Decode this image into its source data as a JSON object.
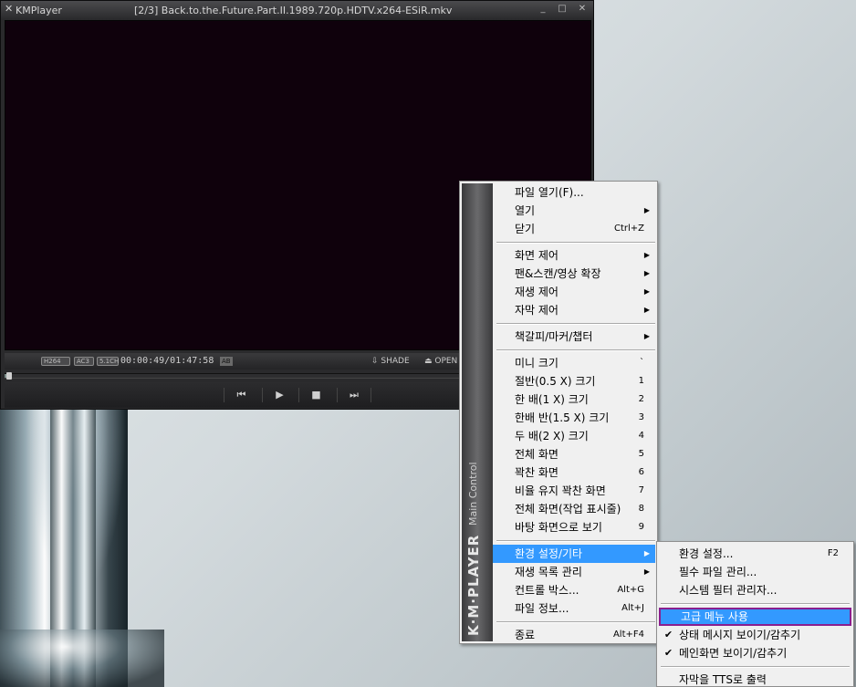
{
  "player": {
    "app_name": "KMPlayer",
    "window_title": "[2/3] Back.to.the.Future.Part.II.1989.720p.HDTV.x264-ESiR.mkv",
    "window_controls": {
      "minimize": "_",
      "maximize": "□",
      "close": "✕"
    },
    "status": {
      "codec_video": "H264",
      "codec_audio": "AC3",
      "codec_channels": "5.1CH",
      "time": "00:00:49/01:47:58",
      "ab_badge": "AB",
      "shade_label": "⇩ SHADE",
      "open_label": "⏏ OPEN"
    },
    "playback_progress": 0.0076,
    "controls": {
      "prev": "⏮",
      "play": "▶",
      "stop": "■",
      "next": "⏭"
    }
  },
  "menu": {
    "banner_brand": "K·M·PLAYER",
    "banner_sub": "Main Control",
    "items": [
      {
        "label": "파일 열기(F)...",
        "accel": "",
        "submenu": false
      },
      {
        "label": "열기",
        "accel": "",
        "submenu": true
      },
      {
        "label": "닫기",
        "accel": "Ctrl+Z",
        "submenu": false
      },
      {
        "label": "화면 제어",
        "accel": "",
        "submenu": true
      },
      {
        "label": "팬&스캔/영상 확장",
        "accel": "",
        "submenu": true
      },
      {
        "label": "재생 제어",
        "accel": "",
        "submenu": true
      },
      {
        "label": "자막 제어",
        "accel": "",
        "submenu": true
      },
      {
        "label": "책갈피/마커/챕터",
        "accel": "",
        "submenu": true
      },
      {
        "label": "미니 크기",
        "accel": "`",
        "submenu": false
      },
      {
        "label": "절반(0.5 X) 크기",
        "accel": "1",
        "submenu": false
      },
      {
        "label": "한 배(1 X) 크기",
        "accel": "2",
        "submenu": false
      },
      {
        "label": "한배 반(1.5 X) 크기",
        "accel": "3",
        "submenu": false
      },
      {
        "label": "두 배(2 X) 크기",
        "accel": "4",
        "submenu": false
      },
      {
        "label": "전체 화면",
        "accel": "5",
        "submenu": false
      },
      {
        "label": "꽉찬 화면",
        "accel": "6",
        "submenu": false
      },
      {
        "label": "비율 유지 꽉찬 화면",
        "accel": "7",
        "submenu": false
      },
      {
        "label": "전체 화면(작업 표시줄)",
        "accel": "8",
        "submenu": false
      },
      {
        "label": "바탕 화면으로 보기",
        "accel": "9",
        "submenu": false
      },
      {
        "label": "환경 설정/기타",
        "accel": "",
        "submenu": true
      },
      {
        "label": "재생 목록 관리",
        "accel": "",
        "submenu": true
      },
      {
        "label": "컨트롤 박스...",
        "accel": "Alt+G",
        "submenu": false
      },
      {
        "label": "파일 정보...",
        "accel": "Alt+J",
        "submenu": false
      },
      {
        "label": "종료",
        "accel": "Alt+F4",
        "submenu": false
      }
    ],
    "submenu_arrow": "▶"
  },
  "submenu": {
    "items": [
      {
        "label": "환경 설정...",
        "accel": "F2",
        "checked": false
      },
      {
        "label": "필수 파일 관리...",
        "accel": "",
        "checked": false
      },
      {
        "label": "시스템 필터 관리자...",
        "accel": "",
        "checked": false
      },
      {
        "label": "고급 메뉴 사용",
        "accel": "",
        "checked": false
      },
      {
        "label": "상태 메시지 보이기/감추기",
        "accel": "",
        "checked": true
      },
      {
        "label": "메인화면 보이기/감추기",
        "accel": "",
        "checked": true
      },
      {
        "label": "자막을 TTS로 출력",
        "accel": "",
        "checked": false
      }
    ],
    "check_mark": "✔"
  }
}
